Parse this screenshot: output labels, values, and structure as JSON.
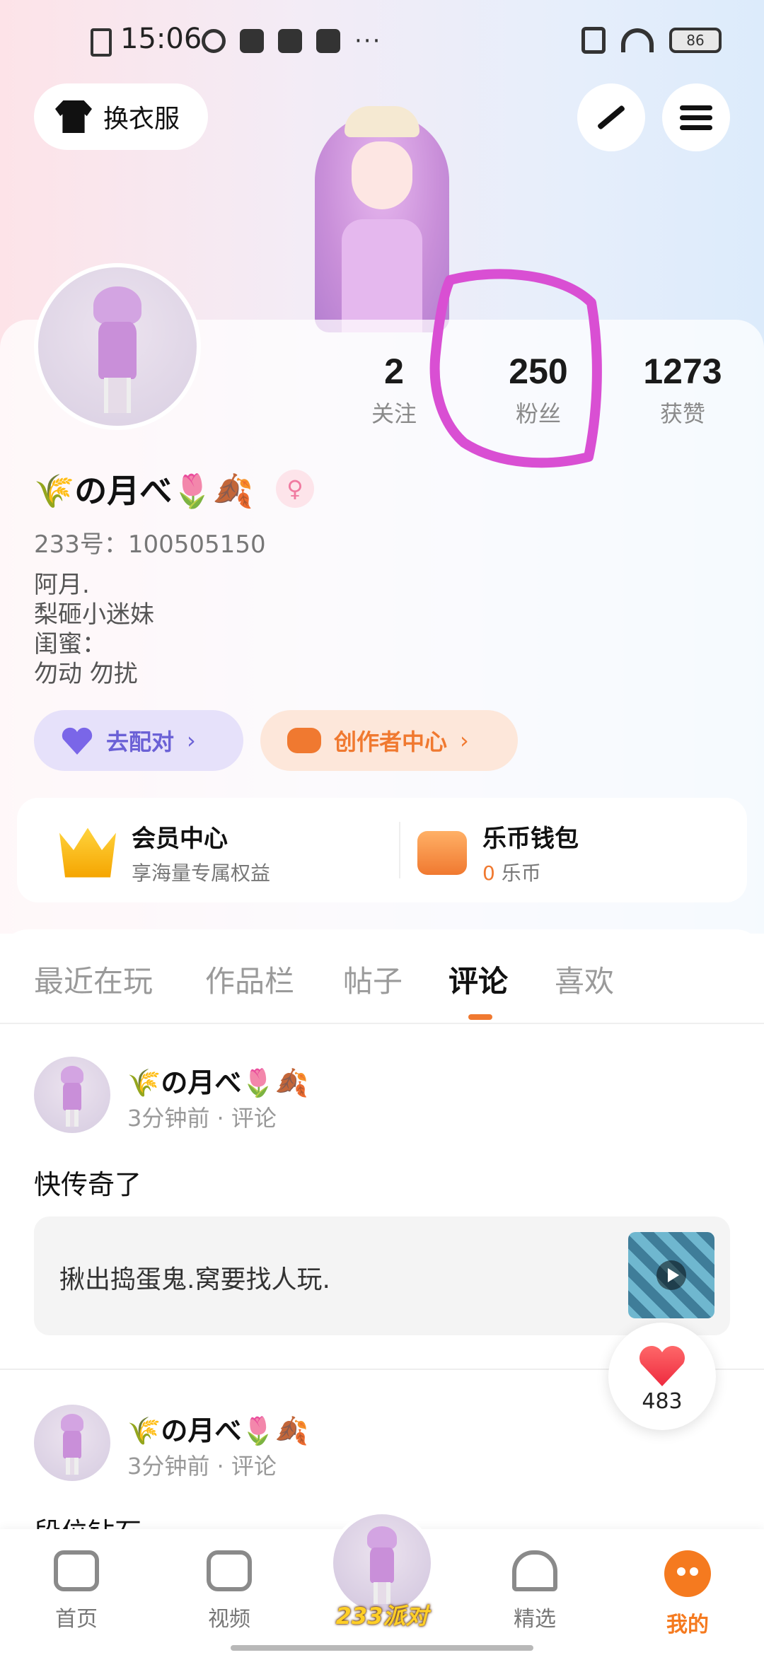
{
  "status_bar": {
    "time": "15:06",
    "battery": "86",
    "more": "···"
  },
  "header": {
    "outfit_label": "换衣服",
    "edit_icon": "pen-icon",
    "menu_icon": "menu-icon"
  },
  "profile": {
    "nickname": "🌾の月べ🌷🍂",
    "gender_icon": "♀",
    "uid": "233号：100505150",
    "bio": [
      "阿月.",
      "梨砸小迷妹",
      "闺蜜：",
      "勿动 勿扰"
    ],
    "stats": [
      {
        "num": "2",
        "label": "关注"
      },
      {
        "num": "250",
        "label": "粉丝"
      },
      {
        "num": "1273",
        "label": "获赞"
      }
    ]
  },
  "actions": {
    "match_label": "去配对",
    "creator_label": "创作者中心",
    "chevron": "›"
  },
  "vip": {
    "member_title": "会员中心",
    "member_sub": "享海量专属权益",
    "wallet_title": "乐币钱包",
    "wallet_coins": "0",
    "wallet_unit": " 乐币"
  },
  "tabs": [
    "最近在玩",
    "作品栏",
    "帖子",
    "评论",
    "喜欢"
  ],
  "active_tab": "评论",
  "posts": [
    {
      "name": "🌾の月べ🌷🍂",
      "meta": "3分钟前  ·  评论",
      "text": "快传奇了",
      "quote": "揪出捣蛋鬼.窝要找人玩."
    },
    {
      "name": "🌾の月べ🌷🍂",
      "meta": "3分钟前  ·  评论",
      "text": "段位钻石"
    }
  ],
  "like_float": {
    "count": "483"
  },
  "bottom_nav": {
    "items": [
      "首页",
      "视频",
      "233派对",
      "精选",
      "我的"
    ],
    "active": "我的"
  },
  "colors": {
    "accent_orange": "#f07930",
    "annotation_magenta": "#d94fd3",
    "match_purple": "#6b61d6"
  }
}
